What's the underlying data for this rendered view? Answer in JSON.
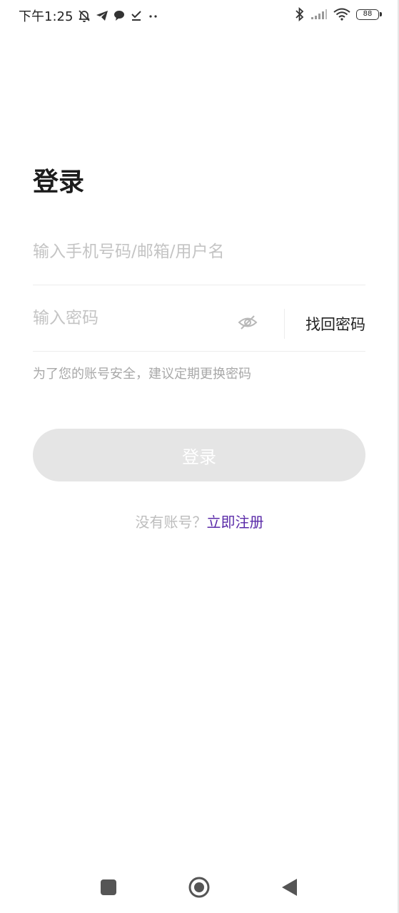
{
  "status_bar": {
    "time": "下午1:25",
    "battery": "88",
    "icons_left": [
      "mute-icon",
      "telegram-icon",
      "chat-icon",
      "download-done-icon",
      "more-dots-icon"
    ],
    "icons_right": [
      "bluetooth-icon",
      "signal-icon",
      "wifi-icon",
      "battery-icon"
    ]
  },
  "page": {
    "title": "登录"
  },
  "account_field": {
    "placeholder": "输入手机号码/邮箱/用户名",
    "value": ""
  },
  "password_field": {
    "placeholder": "输入密码",
    "value": "",
    "toggle_icon": "eye-off-icon",
    "forgot_label": "找回密码"
  },
  "hint": "为了您的账号安全，建议定期更换密码",
  "login_button": {
    "label": "登录",
    "background": "#e5e5e5",
    "text_color": "#ffffff"
  },
  "register": {
    "prompt": "没有账号？",
    "link_label": "立即注册",
    "link_color": "#5a2aa8"
  },
  "nav_bar": {
    "buttons": [
      "recent-apps-icon",
      "home-icon",
      "back-icon"
    ]
  }
}
